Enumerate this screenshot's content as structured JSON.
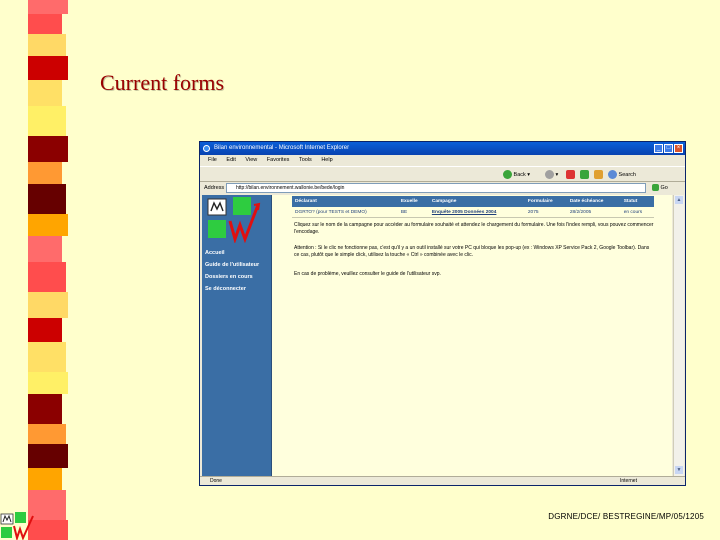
{
  "slide": {
    "title": "Current forms",
    "footer": "DGRNE/DCE/ BESTREGINE/MP/05/1205",
    "stripe_colors": [
      "#ff6b6b",
      "#cc0000",
      "#8b0000",
      "#ffa500",
      "#ffd966",
      "#fff066",
      "#660000",
      "#ff4d4d",
      "#ffe066",
      "#ff9933"
    ]
  },
  "browser": {
    "title": "Bilan environnemental - Microsoft Internet Explorer",
    "menu": [
      "File",
      "Edit",
      "View",
      "Favorites",
      "Tools",
      "Help"
    ],
    "toolbar": {
      "back": "Back",
      "search": "Search"
    },
    "address_label": "Address",
    "address_value": "http://bilan.environnement.wallonie.be/bede/login",
    "go_label": "Go",
    "status_left": "Done",
    "status_right": "Internet"
  },
  "page": {
    "nav": [
      "Accueil",
      "Guide de l'utilisateur",
      "Dossiers en cours",
      "Se déconnecter"
    ],
    "table": {
      "headers": [
        "Déclarant",
        "Exuelle",
        "Campagne",
        "Formulaire",
        "Date échéance",
        "Statut"
      ],
      "rows": [
        [
          "DGRTO? (pour TESTS et DEMO)",
          "BE",
          "Enquête 2005 Données 2004",
          "2075",
          "28/2/2005",
          "en cours"
        ]
      ]
    },
    "messages": [
      "Cliquez sur le nom de la campagne pour accéder au formulaire souhaité et attendez le chargement du formulaire. Une fois l'index rempli, vous pouvez commencer l'encodage.",
      "Attention : Si le clic ne fonctionne pas, c'est qu'il y a un outil installé sur votre PC qui bloque les pop-up (ex : Windows XP Service Pack 2, Google Toolbar). Dans ce cas, plutôt que le simple click, utilisez la touche « Ctrl » combinée avec le clic.",
      "En cas de problème, veuillez consulter le guide de l'utilisateur svp."
    ]
  },
  "colors": {
    "sidebar": "#3a6ea5",
    "page_bg": "#ffffdd",
    "slide_bg": "#ffffcc",
    "title": "#990000"
  }
}
